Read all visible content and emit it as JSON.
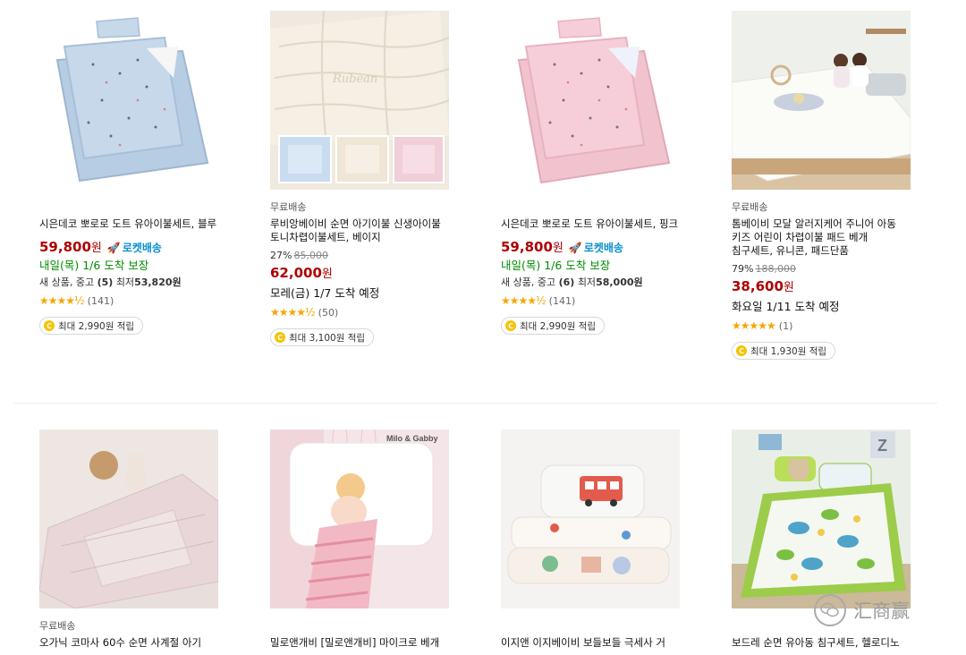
{
  "colors": {
    "price": "#ae0000",
    "rocket": "#0a8fd1",
    "delivery_green": "#008c00",
    "star": "#f7a600",
    "coin": "#f5c300"
  },
  "products_row1": [
    {
      "image": "blue-dot-quilt-set",
      "title": "시은데코 뽀로로 도트 유아이불세트, 블루",
      "price": "59,800",
      "currency": "원",
      "rocket": "로켓배송",
      "delivery": "내일(목) 1/6 도착 보장",
      "used_prefix": "새 상품, 중고",
      "used_count": "(5)",
      "used_mid": "최저",
      "used_price": "53,820원",
      "stars": "★★★★½",
      "rating_value": 4.5,
      "reviews": "(141)",
      "cashback": "최대 2,990원 적립"
    },
    {
      "image": "cream-quilted-blanket",
      "free_shipping": "무료배송",
      "title": "루비앙베이비 순면 아기이불 신생아이불 토니차렵이불세트, 베이지",
      "discount": "27%",
      "original_price": "85,000",
      "price": "62,000",
      "currency": "원",
      "delivery": "모레(금) 1/7 도착 예정",
      "stars": "★★★★½",
      "rating_value": 4.5,
      "reviews": "(50)",
      "cashback": "최대 3,100원 적립"
    },
    {
      "image": "pink-dot-quilt-set",
      "title": "시은데코 뽀로로 도트 유아이불세트, 핑크",
      "price": "59,800",
      "currency": "원",
      "rocket": "로켓배송",
      "delivery": "내일(목) 1/6 도착 보장",
      "used_prefix": "새 상품, 중고",
      "used_count": "(6)",
      "used_mid": "최저",
      "used_price": "58,000원",
      "stars": "★★★★½",
      "rating_value": 4.5,
      "reviews": "(141)",
      "cashback": "최대 2,990원 적립"
    },
    {
      "image": "kids-on-bed",
      "free_shipping": "무료배송",
      "title": "톰베이비 모달 알러지케어 주니어 아동 키즈 어린이 차렵이불 패드 베개 침구세트, 유니콘, 패드단품",
      "discount": "79%",
      "original_price": "188,000",
      "price": "38,600",
      "currency": "원",
      "delivery": "화요일 1/11 도착 예정",
      "stars": "★★★★★",
      "rating_value": 5,
      "reviews": "(1)",
      "cashback": "최대 1,930원 적립"
    }
  ],
  "products_row2": [
    {
      "image": "pink-organic-quilt",
      "free_shipping": "무료배송",
      "title": "오가닉 코마사 60수 순면 사계절 아기"
    },
    {
      "image": "girl-on-bunny-pillow",
      "brand_overlay": "Milo & Gabby",
      "title": "밀로앤개비 [밀로앤개비] 마이크로 베개"
    },
    {
      "image": "bus-pattern-bedding",
      "title": "이지앤 이지베이비 보들보들 극세사 거"
    },
    {
      "image": "dino-nap-mat",
      "title": "보드레 순면 유아동 침구세트, 헬로디노"
    }
  ],
  "watermark": {
    "icon": "wechat-icon",
    "text": "汇商赢"
  }
}
